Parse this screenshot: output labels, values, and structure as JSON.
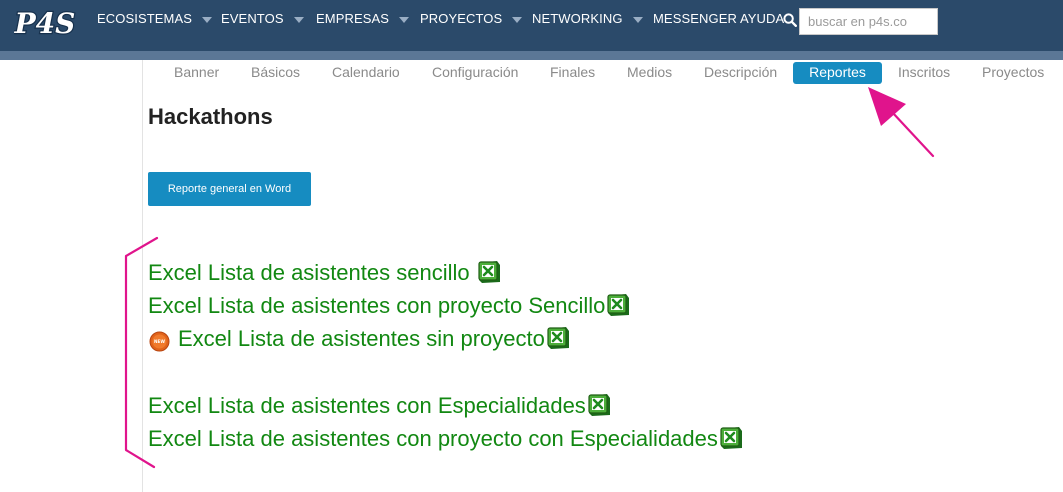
{
  "brand": {
    "logo_text": "P4S"
  },
  "nav": {
    "items": [
      {
        "label": "ECOSISTEMAS",
        "has_caret": true
      },
      {
        "label": "EVENTOS",
        "has_caret": true
      },
      {
        "label": "EMPRESAS",
        "has_caret": true
      },
      {
        "label": "PROYECTOS",
        "has_caret": true
      },
      {
        "label": "NETWORKING",
        "has_caret": true
      },
      {
        "label": "MESSENGER AYUDA",
        "has_caret": false
      }
    ]
  },
  "search": {
    "placeholder": "buscar en p4s.co",
    "value": "",
    "icon": "search-icon"
  },
  "tabs": [
    {
      "label": "Banner",
      "active": false
    },
    {
      "label": "Básicos",
      "active": false
    },
    {
      "label": "Calendario",
      "active": false
    },
    {
      "label": "Configuración",
      "active": false
    },
    {
      "label": "Finales",
      "active": false
    },
    {
      "label": "Medios",
      "active": false
    },
    {
      "label": "Descripción",
      "active": false
    },
    {
      "label": "Reportes",
      "active": true
    },
    {
      "label": "Inscritos",
      "active": false
    },
    {
      "label": "Proyectos",
      "active": false
    }
  ],
  "page": {
    "title": "Hackathons",
    "word_report_button": "Reporte general en Word"
  },
  "excel_reports": [
    {
      "label": "Excel Lista de asistentes sencillo ",
      "icon": "excel-icon",
      "is_new": false
    },
    {
      "label": "Excel Lista de asistentes con proyecto Sencillo",
      "icon": "excel-icon",
      "is_new": false
    },
    {
      "label": "Excel Lista de asistentes sin proyecto",
      "icon": "excel-icon",
      "is_new": true,
      "badge_text": "NEW"
    },
    {
      "label": "Excel Lista de asistentes con Especialidades",
      "icon": "excel-icon",
      "is_new": false
    },
    {
      "label": "Excel Lista de asistentes con proyecto con Especialidades",
      "icon": "excel-icon",
      "is_new": false
    }
  ],
  "colors": {
    "topbar": "#2b4a6a",
    "topbar_strip": "#5b7796",
    "accent_blue": "#168cc1",
    "link_green": "#128812",
    "annotation_magenta": "#e0148c"
  }
}
